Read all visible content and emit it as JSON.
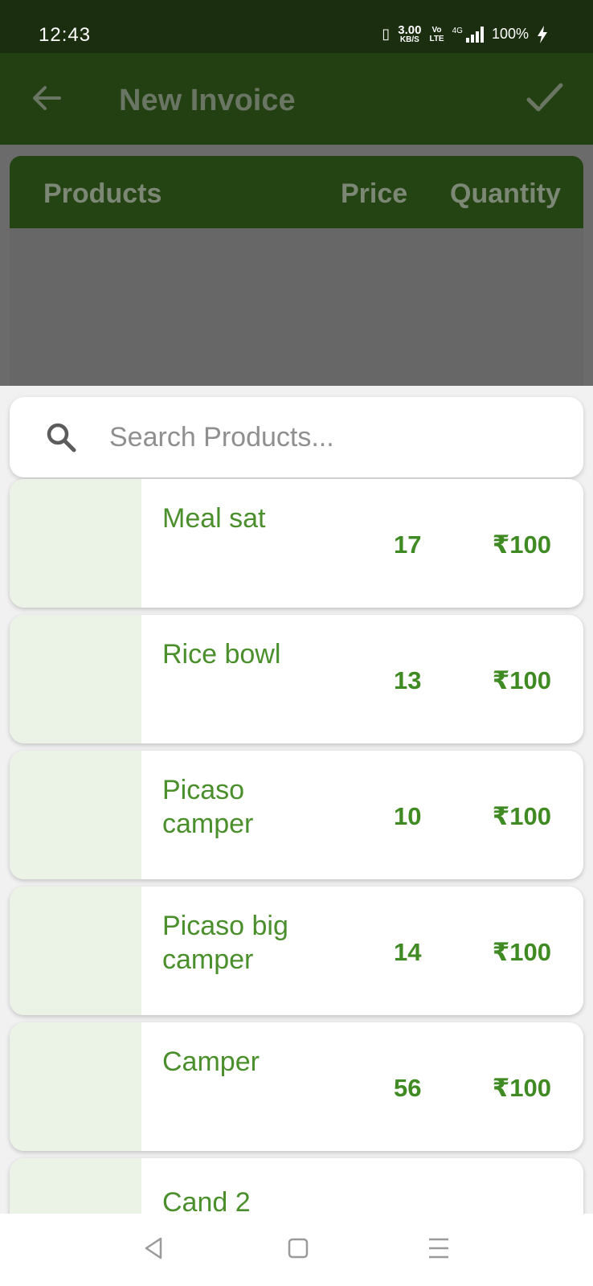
{
  "status_bar": {
    "time": "12:43",
    "speed_value": "3.00",
    "speed_unit": "KB/S",
    "volte_top": "Vo",
    "volte_bottom": "LTE",
    "network": "4G",
    "battery": "100%"
  },
  "app_bar": {
    "title": "New Invoice",
    "back_icon": "arrow-left-icon",
    "confirm_icon": "check-icon"
  },
  "table_header": {
    "products": "Products",
    "price": "Price",
    "quantity": "Quantity"
  },
  "search": {
    "placeholder": "Search Products...",
    "value": ""
  },
  "products": [
    {
      "name": "Meal sat",
      "qty": "17",
      "price": "₹100"
    },
    {
      "name": "Rice bowl",
      "qty": "13",
      "price": "₹100"
    },
    {
      "name": "Picaso camper",
      "qty": "10",
      "price": "₹100"
    },
    {
      "name": "Picaso big camper",
      "qty": "14",
      "price": "₹100"
    },
    {
      "name": "Camper",
      "qty": "56",
      "price": "₹100"
    },
    {
      "name": "Cand  2",
      "qty": "",
      "price": ""
    }
  ],
  "colors": {
    "status_bar": "#1b2e10",
    "app_bar": "#224012",
    "accent_green": "#3f8a22",
    "thumb_bg": "#ebf3e6"
  }
}
